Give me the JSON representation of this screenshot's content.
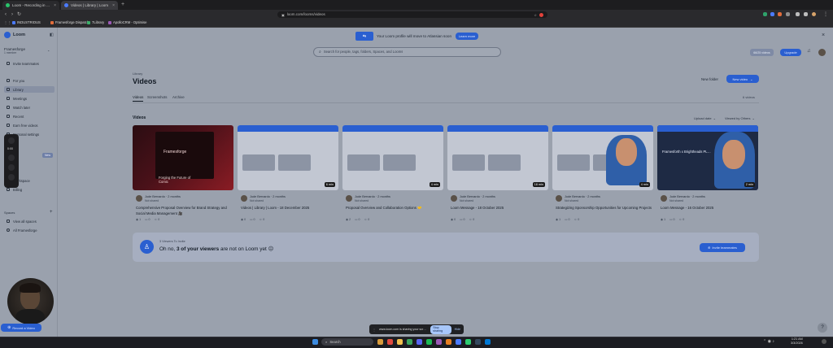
{
  "browser": {
    "tabs": [
      {
        "label": "Loom - Recording in progress"
      },
      {
        "label": "Videos | Library | Loom"
      },
      {
        "label": "New tab"
      }
    ],
    "url": "loom.com/looms/videos",
    "bookmarks": [
      "INDUSTRIOUS",
      "Framesforge Dispatch",
      "7Library",
      "ApolloCRM - Optimise"
    ]
  },
  "banner": {
    "text": "Your Loom profile will move to Atlassian soon",
    "button": "Learn more"
  },
  "search": {
    "placeholder": "Search for people, tags, folders, Spaces, and Looms"
  },
  "header": {
    "usage": "66/25 videos",
    "upgrade": "Upgrade"
  },
  "sidebar": {
    "brand": "Loom",
    "workspace": "Framesforge",
    "workspace_sub": "1 member",
    "invite": "Invite teammates",
    "items": [
      "For you",
      "Library",
      "Meetings",
      "Watch later",
      "Recent",
      "Earn free videos",
      "Personal settings"
    ],
    "new_badge": "New",
    "items2": [
      "Ins",
      "Ma",
      "Ad",
      "Workspace",
      "Billing"
    ],
    "spaces_label": "Spaces",
    "spaces": [
      "View all spaces",
      "All Framesforge"
    ]
  },
  "library": {
    "crumb": "Library",
    "title": "Videos",
    "new_folder": "New folder",
    "new_video": "New video",
    "tabs": [
      "Videos",
      "Screenshots",
      "Archive"
    ],
    "count": "6 videos",
    "section": "Videos",
    "sort": "Upload date",
    "filter": "Viewed by Others"
  },
  "videos": [
    {
      "author": "Jude Bernardo",
      "time": "2 months",
      "sub": "Not shared",
      "title": "Comprehensive Proposal Overview for Brand Strategy and Social Media Management 🎥",
      "duration": "",
      "views": "1",
      "comments": "0",
      "reactions": "0",
      "thumb_text": "Framesforge",
      "thumb_caption": "Forging the Future of Comic"
    },
    {
      "author": "Jude Bernardo",
      "time": "2 months",
      "sub": "Not shared",
      "title": "Videos | Library | Loom - 18 December 2025",
      "duration": "6 min",
      "views": "0",
      "comments": "0",
      "reactions": "0"
    },
    {
      "author": "Jude Bernardo",
      "time": "2 months",
      "sub": "Not shared",
      "title": "Proposal Overview and Collaboration Options 🤝",
      "duration": "4 min",
      "views": "2",
      "comments": "0",
      "reactions": "0"
    },
    {
      "author": "Jude Bernardo",
      "time": "2 months",
      "sub": "Not shared",
      "title": "Loom Message - 18 October 2025",
      "duration": "18 min",
      "views": "0",
      "comments": "0",
      "reactions": "0"
    },
    {
      "author": "Jude Bernardo",
      "time": "2 months",
      "sub": "Not shared",
      "title": "Strategizing Sponsorship Opportunities for Upcoming Projects",
      "duration": "4 min",
      "views": "1",
      "comments": "0",
      "reactions": "0"
    },
    {
      "author": "Jude Bernardo",
      "time": "2 months",
      "sub": "Not shared",
      "title": "Loom Message - 16 October 2025",
      "duration": "2 min",
      "views": "1",
      "comments": "0",
      "reactions": "0",
      "thumb_text": "Framesforth x Brightheads PLAY"
    }
  ],
  "viewers_banner": {
    "label": "3 Viewers To Invite",
    "text_pre": "Oh no, ",
    "text_bold": "3 of your viewers",
    "text_post": " are not on Loom yet ☹",
    "button": "Invite teammates"
  },
  "share_bar": {
    "text": "www.loom.com is sharing your screen.",
    "stop": "Stop sharing",
    "hide": "Hide"
  },
  "record_button": "Record a Video",
  "taskbar": {
    "search": "Search",
    "time": "1:21 AM",
    "date": "3/3/2026"
  },
  "colors": {
    "accent": "#2a5fd0",
    "overlay": "#9aa1ad"
  }
}
